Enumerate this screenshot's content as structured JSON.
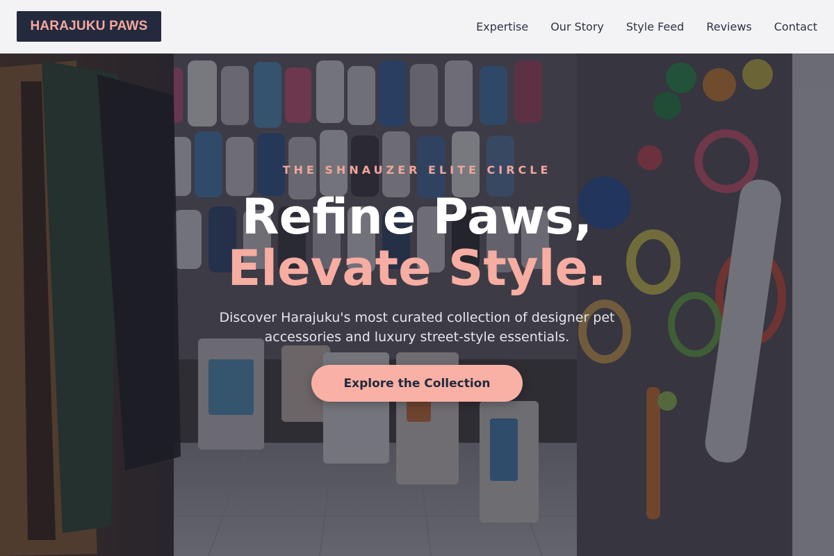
{
  "header": {
    "logo_text": "HARAJUKU PAWS",
    "nav": [
      {
        "label": "Expertise"
      },
      {
        "label": "Our Story"
      },
      {
        "label": "Style Feed"
      },
      {
        "label": "Reviews"
      },
      {
        "label": "Contact"
      }
    ]
  },
  "hero": {
    "eyebrow": "THE SHNAUZER ELITE CIRCLE",
    "headline_line1": "Refine Paws,",
    "headline_line2": "Elevate Style.",
    "subtext": "Discover Harajuku's most curated collection of designer pet accessories and luxury street-style essentials.",
    "cta_label": "Explore the Collection",
    "background_image": "pet-shop-interior-photo"
  },
  "colors": {
    "brand_navy": "#232a3d",
    "accent_pink": "#f7ada1",
    "header_bg": "#f3f3f5"
  }
}
